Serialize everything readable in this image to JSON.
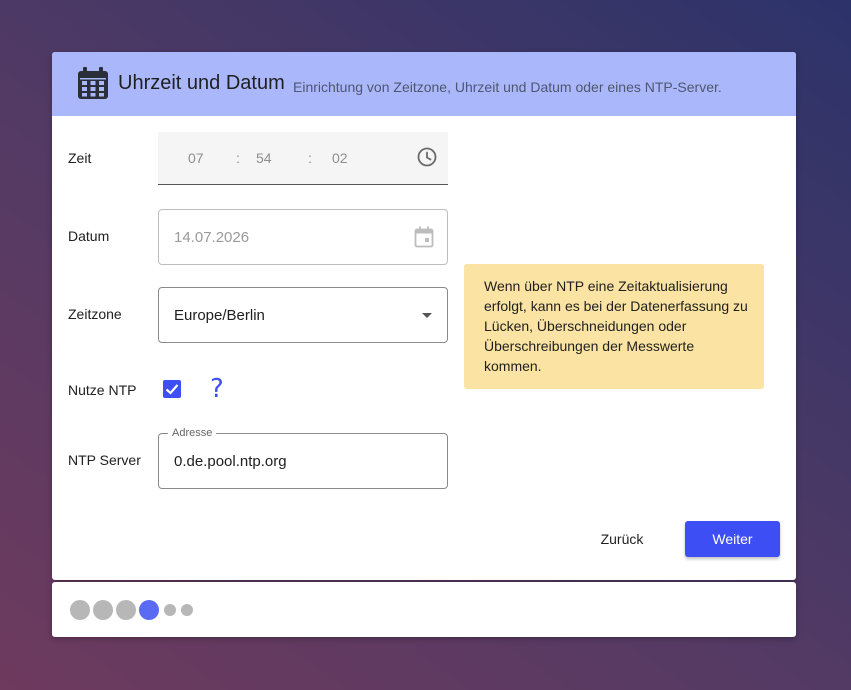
{
  "header": {
    "icon": "calendar-icon",
    "title": "Uhrzeit und Datum",
    "subtitle": "Einrichtung von Zeitzone, Uhrzeit und Datum oder eines NTP-Server."
  },
  "form": {
    "time": {
      "label": "Zeit",
      "hours": "07",
      "minutes": "54",
      "seconds": "02",
      "separator": ":",
      "icon": "clock-icon"
    },
    "date": {
      "label": "Datum",
      "value": "14.07.2026",
      "icon": "calendar-icon"
    },
    "timezone": {
      "label": "Zeitzone",
      "value": "Europe/Berlin"
    },
    "ntp": {
      "label": "Nutze NTP",
      "checked": true,
      "help": "?"
    },
    "ntp_server": {
      "label": "NTP Server",
      "legend": "Adresse",
      "value": "0.de.pool.ntp.org"
    }
  },
  "notice": {
    "text": "Wenn über NTP eine Zeitaktualisierung erfolgt, kann es bei der Datenerfassung zu Lücken, Überschneidungen oder Überschreibungen der Messwerte kommen."
  },
  "actions": {
    "back_label": "Zurück",
    "next_label": "Weiter"
  },
  "stepper": {
    "total_steps": 6,
    "current_step": 4
  },
  "colors": {
    "header_bg": "#aab8fb",
    "accent": "#3d4ef4",
    "notice_bg": "#fae3a3",
    "active_step": "#5b6af3",
    "inactive_step": "#b7b7b7"
  }
}
